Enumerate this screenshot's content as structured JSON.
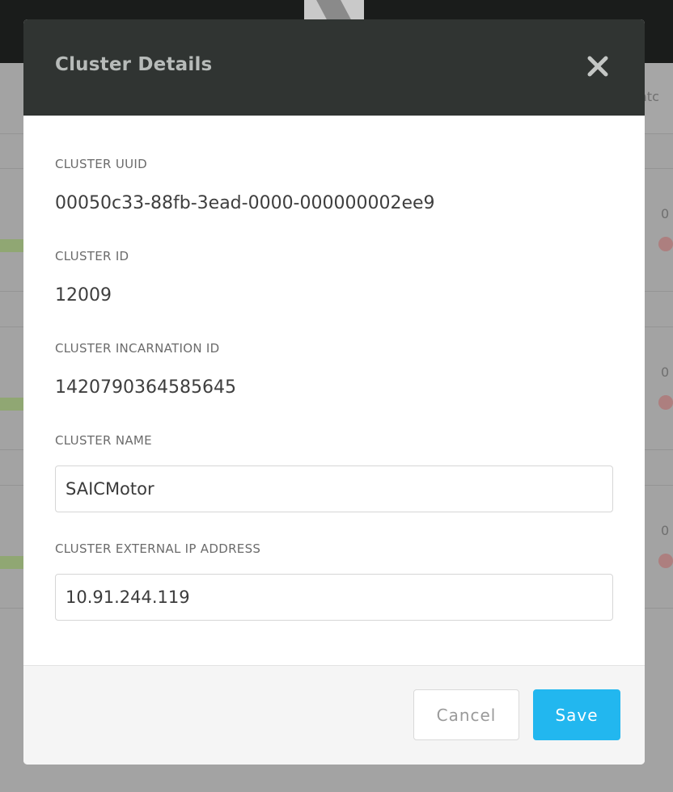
{
  "background": {
    "column_header_fragment": "atc",
    "row_fragments": [
      "0",
      "0",
      "0"
    ]
  },
  "dialog": {
    "title": "Cluster Details",
    "close_icon": "close-icon",
    "fields": {
      "uuid": {
        "label": "CLUSTER UUID",
        "value": "00050c33-88fb-3ead-0000-000000002ee9"
      },
      "id": {
        "label": "CLUSTER ID",
        "value": "12009"
      },
      "incarnation_id": {
        "label": "CLUSTER INCARNATION ID",
        "value": "1420790364585645"
      },
      "name": {
        "label": "CLUSTER NAME",
        "value": "SAICMotor"
      },
      "external_ip": {
        "label": "CLUSTER EXTERNAL IP ADDRESS",
        "value": "10.91.244.119"
      }
    },
    "buttons": {
      "cancel": "Cancel",
      "save": "Save"
    }
  },
  "colors": {
    "header_bg": "#303432",
    "save_button": "#22b7ef",
    "overlay": "#a3a3a3"
  }
}
